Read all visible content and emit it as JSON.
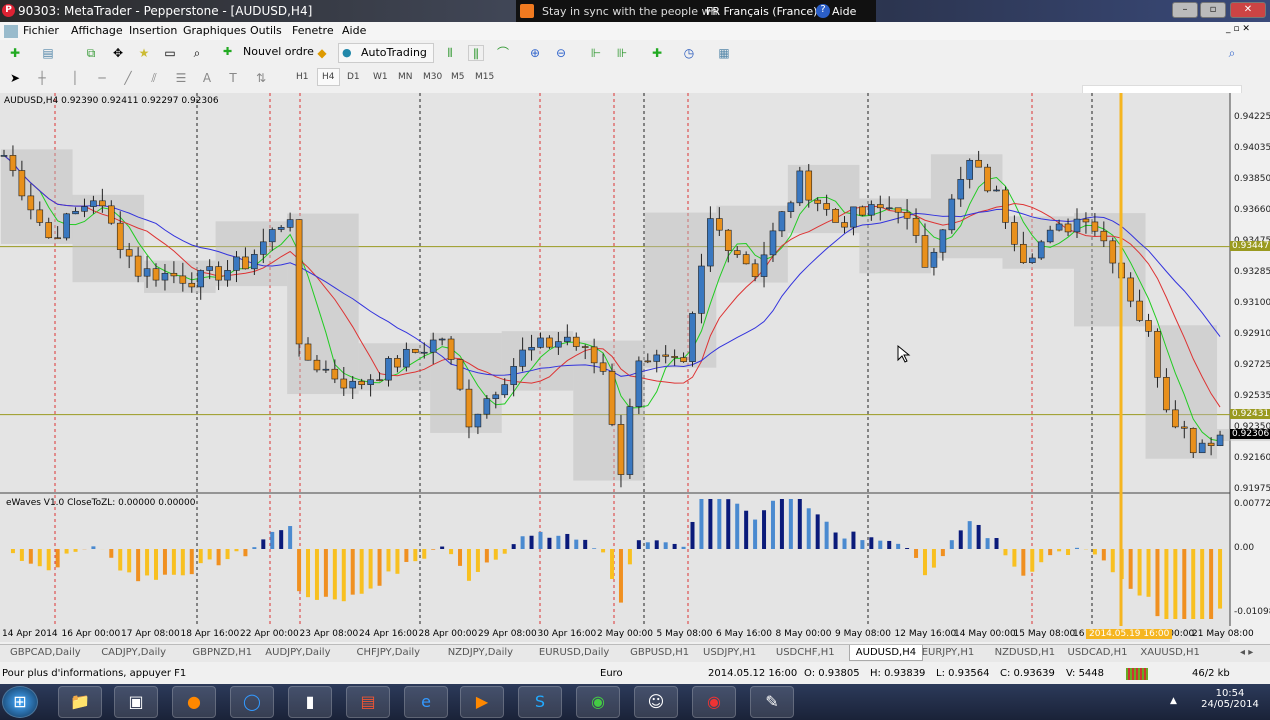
{
  "window": {
    "title": "90303: MetaTrader - Pepperstone - [AUDUSD,H4]",
    "notification": "Stay in sync with the people wh",
    "language": "FR Français (France)",
    "help": "Aide"
  },
  "menu": [
    "Fichier",
    "Affichage",
    "Insertion",
    "Graphiques",
    "Outils",
    "Fenetre",
    "Aide"
  ],
  "toolbar": {
    "new_order": "Nouvel ordre",
    "autotrading": "AutoTrading",
    "search_placeholder": ""
  },
  "timeframes": [
    "H1",
    "H4",
    "D1",
    "W1",
    "MN",
    "M30",
    "M5",
    "M15"
  ],
  "active_timeframe": "H4",
  "chart_data": {
    "type": "candlestick",
    "symbol_label": "AUDUSD,H4  0.92390 0.92411 0.92297 0.92306",
    "indicator_label": "eWaves V1.0 CloseToZL: 0.00000 0.00000",
    "ylim": [
      0.91975,
      0.94225
    ],
    "yticks": [
      "0.94225",
      "0.94035",
      "0.93850",
      "0.93660",
      "0.93475",
      "0.93285",
      "0.93100",
      "0.92910",
      "0.92725",
      "0.92535",
      "0.92350",
      "0.92160",
      "0.91975"
    ],
    "hlines": [
      {
        "price": 0.93447,
        "label": "0.93447"
      },
      {
        "price": 0.92431,
        "label": "0.92431"
      }
    ],
    "current_price": "0.92306",
    "indicator_ticks": [
      "0.007726",
      "0.00",
      "-0.010981"
    ],
    "price_path": [
      [
        0,
        0.94
      ],
      [
        5,
        0.935
      ],
      [
        10,
        0.9375
      ],
      [
        15,
        0.933
      ],
      [
        22,
        0.9325
      ],
      [
        27,
        0.9335
      ],
      [
        32,
        0.9365
      ],
      [
        33,
        0.928
      ],
      [
        39,
        0.926
      ],
      [
        44,
        0.9275
      ],
      [
        49,
        0.929
      ],
      [
        52,
        0.924
      ],
      [
        58,
        0.928
      ],
      [
        63,
        0.929
      ],
      [
        67,
        0.927
      ],
      [
        69,
        0.921
      ],
      [
        71,
        0.928
      ],
      [
        76,
        0.927
      ],
      [
        79,
        0.936
      ],
      [
        84,
        0.933
      ],
      [
        89,
        0.9385
      ],
      [
        93,
        0.936
      ],
      [
        100,
        0.937
      ],
      [
        103,
        0.9335
      ],
      [
        108,
        0.9395
      ],
      [
        111,
        0.9375
      ],
      [
        114,
        0.934
      ],
      [
        121,
        0.9365
      ],
      [
        124,
        0.934
      ],
      [
        128,
        0.929
      ],
      [
        130,
        0.925
      ],
      [
        133,
        0.9225
      ],
      [
        136,
        0.9231
      ]
    ],
    "x_labels": [
      "14 Apr 2014",
      "16 Apr 00:00",
      "17 Apr 08:00",
      "18 Apr 16:00",
      "22 Apr 00:00",
      "23 Apr 08:00",
      "24 Apr 16:00",
      "28 Apr 00:00",
      "29 Apr 08:00",
      "30 Apr 16:00",
      "2 May 00:00",
      "5 May 08:00",
      "6 May 16:00",
      "8 May 00:00",
      "9 May 08:00",
      "12 May 16:00",
      "14 May 00:00",
      "15 May 08:00",
      "16 May 16:00",
      "20 May 00:00",
      "21 May 08:00"
    ],
    "cursor_time": "2014.05.19 16:00",
    "colors": {
      "bull": "#3a78c0",
      "bear": "#e8901c",
      "ma_fast": "#22cc22",
      "ma_mid": "#dd3333",
      "ma_slow": "#3333dd",
      "hist_pos_dark": "#0a1a7a",
      "hist_pos_light": "#4a8ad0",
      "hist_neg": "#f8c020",
      "hist_neg_dark": "#f09020"
    }
  },
  "symbol_tabs": [
    "GBPCAD,Daily",
    "CADJPY,Daily",
    "GBPNZD,H1",
    "AUDJPY,Daily",
    "CHFJPY,Daily",
    "NZDJPY,Daily",
    "EURUSD,Daily",
    "GBPUSD,H1",
    "USDJPY,H1",
    "USDCHF,H1",
    "AUDUSD,H4",
    "EURJPY,H1",
    "NZDUSD,H1",
    "USDCAD,H1",
    "XAUUSD,H1"
  ],
  "active_tab": "AUDUSD,H4",
  "status": {
    "help": "Pour plus d'informations, appuyer F1",
    "profile": "Euro",
    "time": "2014.05.12 16:00",
    "open": "O: 0.93805",
    "high": "H: 0.93839",
    "low": "L: 0.93564",
    "close": "C: 0.93639",
    "volume": "V: 5448",
    "traffic": "46/2 kb"
  },
  "clock": {
    "time": "10:54",
    "date": "24/05/2014"
  }
}
